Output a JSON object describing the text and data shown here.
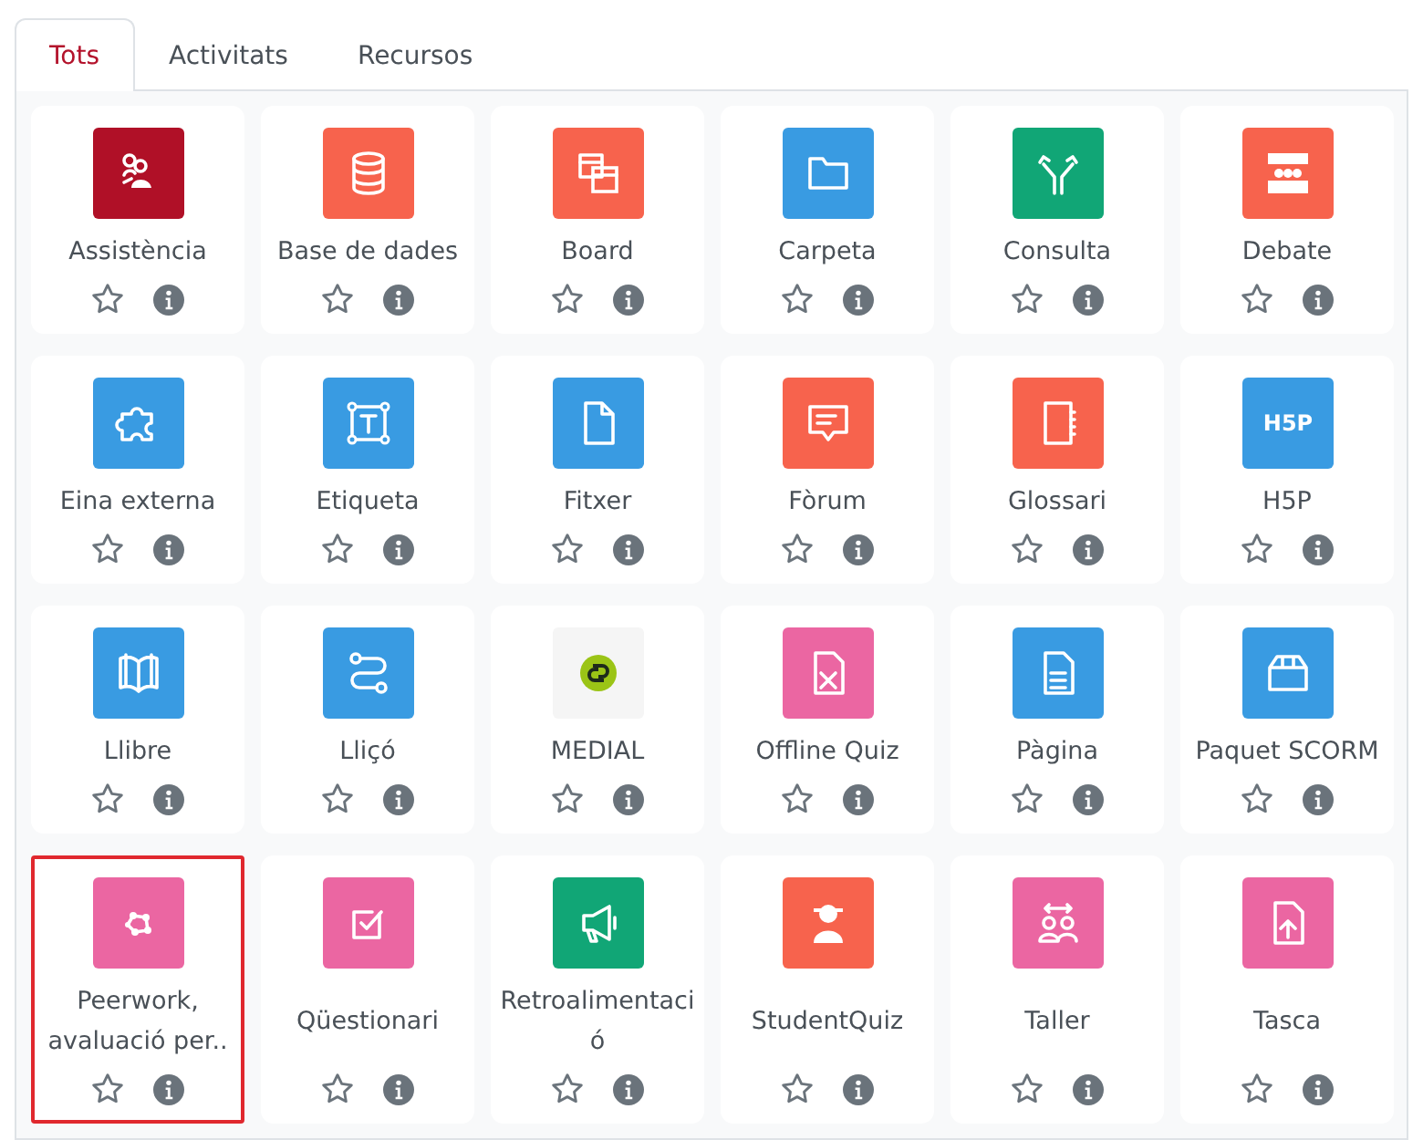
{
  "tabs": [
    {
      "label": "Tots",
      "selected": true
    },
    {
      "label": "Activitats",
      "selected": false
    },
    {
      "label": "Recursos",
      "selected": false
    }
  ],
  "modules": [
    {
      "label": "Assistència",
      "kind": "people",
      "color": "#b01027",
      "starred": false,
      "highlighted": false
    },
    {
      "label": "Base de dades",
      "kind": "database",
      "color": "#f7634d",
      "starred": false,
      "highlighted": false
    },
    {
      "label": "Board",
      "kind": "windows",
      "color": "#f7634d",
      "starred": false,
      "highlighted": false
    },
    {
      "label": "Carpeta",
      "kind": "folder",
      "color": "#399be2",
      "starred": false,
      "highlighted": false
    },
    {
      "label": "Consulta",
      "kind": "fork",
      "color": "#11a676",
      "starred": false,
      "highlighted": false
    },
    {
      "label": "Debate",
      "kind": "crowd",
      "color": "#f7634d",
      "starred": false,
      "highlighted": false
    },
    {
      "label": "Eina externa",
      "kind": "puzzle",
      "color": "#399be2",
      "starred": false,
      "highlighted": false
    },
    {
      "label": "Etiqueta",
      "kind": "textframe",
      "color": "#399be2",
      "starred": false,
      "highlighted": false
    },
    {
      "label": "Fitxer",
      "kind": "file",
      "color": "#399be2",
      "starred": false,
      "highlighted": false
    },
    {
      "label": "Fòrum",
      "kind": "chat",
      "color": "#f7634d",
      "starred": false,
      "highlighted": false
    },
    {
      "label": "Glossari",
      "kind": "notebook",
      "color": "#f7634d",
      "starred": false,
      "highlighted": false
    },
    {
      "label": "H5P",
      "kind": "logotext",
      "icon_text": "H5P",
      "color": "#399be2",
      "starred": false,
      "highlighted": false
    },
    {
      "label": "Llibre",
      "kind": "book",
      "color": "#399be2",
      "starred": false,
      "highlighted": false
    },
    {
      "label": "Lliçó",
      "kind": "path",
      "color": "#399be2",
      "starred": false,
      "highlighted": false
    },
    {
      "label": "MEDIAL",
      "kind": "links",
      "color": "#f5f5f5",
      "starred": false,
      "highlighted": false
    },
    {
      "label": "Offline Quiz",
      "kind": "docx",
      "color": "#eb66a2",
      "starred": false,
      "highlighted": false
    },
    {
      "label": "Pàgina",
      "kind": "doclines",
      "color": "#399be2",
      "starred": false,
      "highlighted": false
    },
    {
      "label": "Paquet SCORM",
      "kind": "box",
      "color": "#399be2",
      "starred": false,
      "highlighted": false
    },
    {
      "label": "Peerwork, avaluació per..",
      "kind": "ring",
      "color": "#eb66a2",
      "starred": false,
      "highlighted": true
    },
    {
      "label": "Qüestionari",
      "kind": "check",
      "color": "#eb66a2",
      "starred": false,
      "highlighted": false
    },
    {
      "label": "Retroalimentació",
      "kind": "megaphone",
      "color": "#11a676",
      "starred": false,
      "highlighted": false
    },
    {
      "label": "StudentQuiz",
      "kind": "figure",
      "color": "#f7634d",
      "starred": false,
      "highlighted": false
    },
    {
      "label": "Taller",
      "kind": "pair",
      "color": "#eb66a2",
      "starred": false,
      "highlighted": false
    },
    {
      "label": "Tasca",
      "kind": "upload",
      "color": "#eb66a2",
      "starred": false,
      "highlighted": false
    }
  ]
}
